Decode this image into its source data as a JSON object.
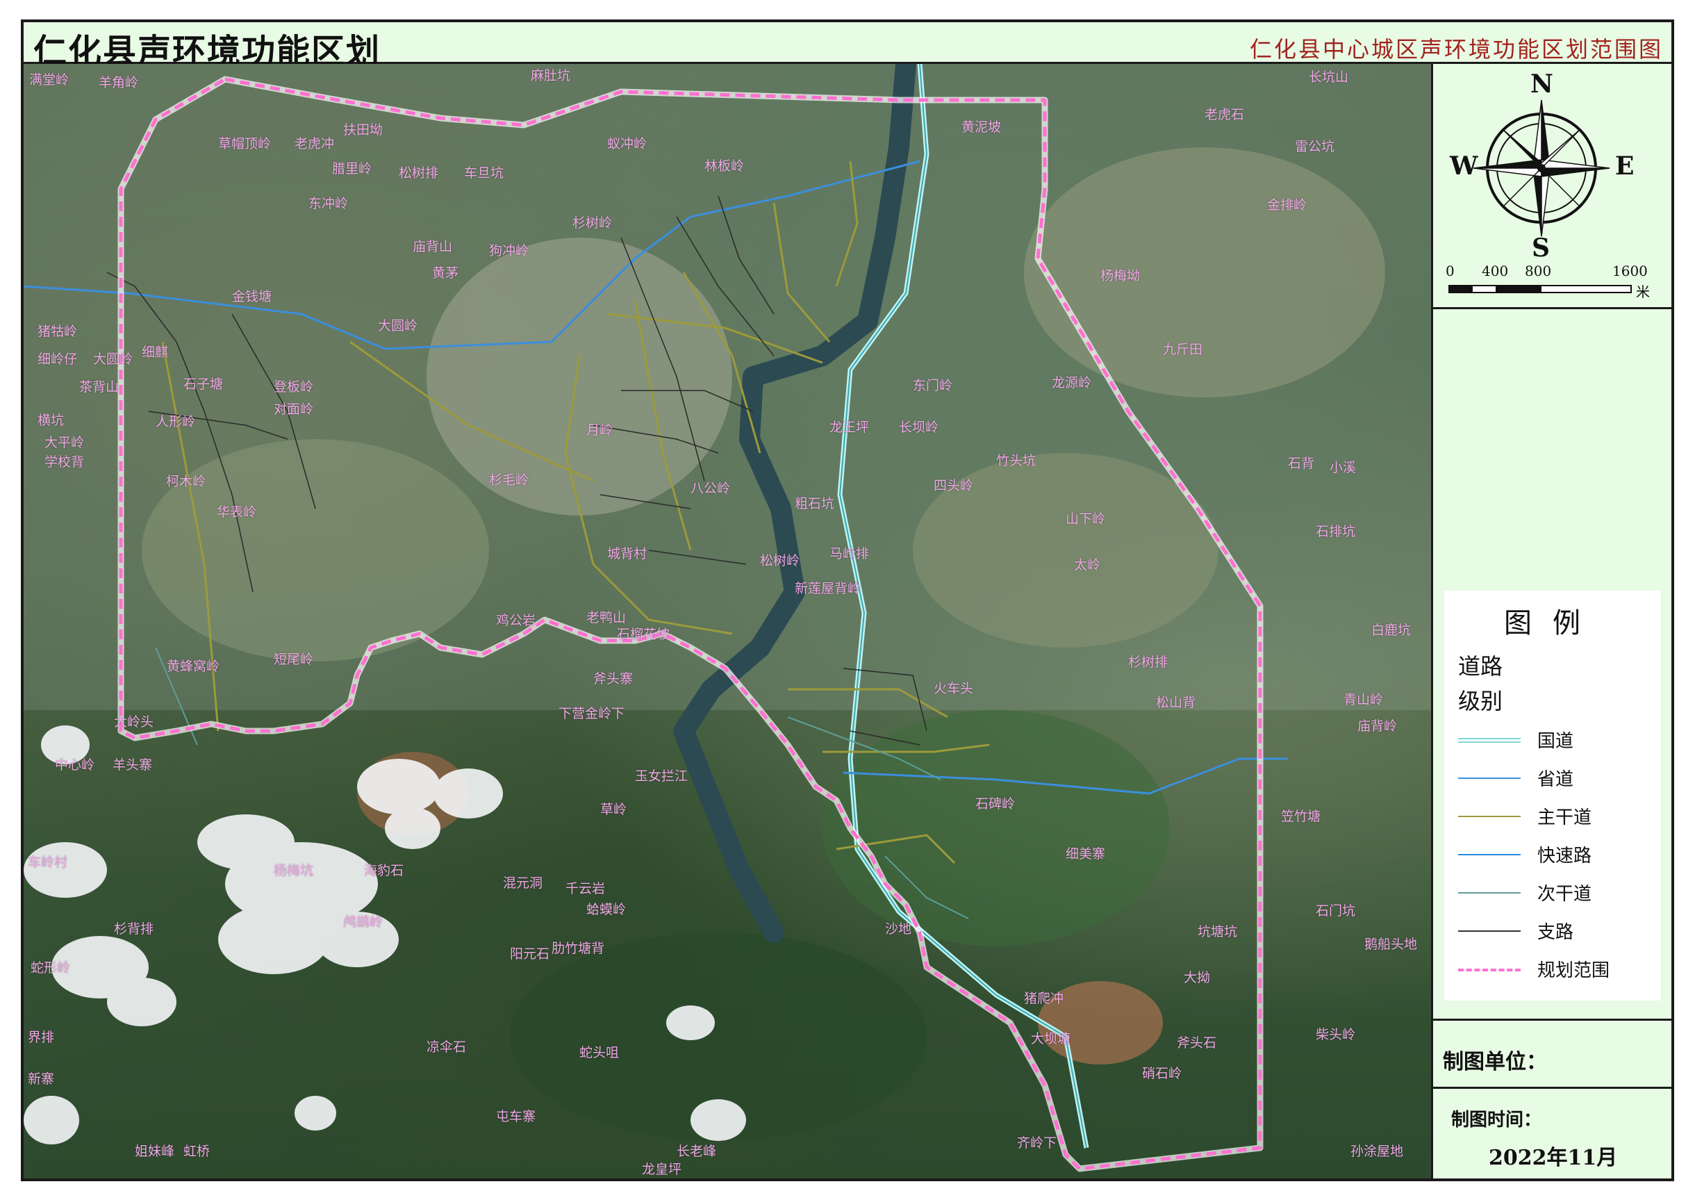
{
  "header": {
    "title": "仁化县声环境功能区划",
    "subtitle": "仁化县中心城区声环境功能区划范围图"
  },
  "compass": {
    "north": "N",
    "south": "S",
    "east": "E",
    "west": "W"
  },
  "scale_bar": {
    "ticks": [
      "0",
      "400",
      "800",
      "1600"
    ],
    "unit": "米"
  },
  "legend": {
    "title": "图例",
    "group_title": "道路",
    "group_subtitle": "级别",
    "items": [
      {
        "label": "国道",
        "color": "#7fd8d8",
        "style": "double"
      },
      {
        "label": "省道",
        "color": "#3b8fdc",
        "style": "solid"
      },
      {
        "label": "主干道",
        "color": "#9c9a3c",
        "style": "solid"
      },
      {
        "label": "快速路",
        "color": "#2a8ce0",
        "style": "solid"
      },
      {
        "label": "次干道",
        "color": "#5e9e96",
        "style": "solid"
      },
      {
        "label": "支路",
        "color": "#333333",
        "style": "solid"
      },
      {
        "label": "规划范围",
        "color": "#ff6fd0",
        "style": "dashed"
      }
    ]
  },
  "map_unit": {
    "label": "制图单位："
  },
  "map_time": {
    "label": "制图时间：",
    "value": "2022年11月"
  },
  "place_names": [
    "满堂岭",
    "羊角岭",
    "麻肚坑",
    "长坑山",
    "老虎石",
    "扶田坳",
    "草帽顶岭",
    "老虎冲",
    "黄泥坡",
    "蚁冲岭",
    "林板岭",
    "雷公坑",
    "腊里岭",
    "松树排",
    "车旦坑",
    "东冲岭",
    "金排岭",
    "杉树岭",
    "庙背山",
    "狗冲岭",
    "黄茅",
    "杨梅坳",
    "金钱塘",
    "大圆岭",
    "猪牯岭",
    "细岭仔",
    "大圆岭",
    "细麒",
    "石子塘",
    "茶背山",
    "登板岭",
    "对面岭",
    "九斤田",
    "东门岭",
    "龙源岭",
    "龙王坪",
    "长坝岭",
    "人形岭",
    "大平岭",
    "学校背",
    "横坑",
    "柯木岭",
    "杉毛岭",
    "月岭",
    "八公岭",
    "竹头坑",
    "四头岭",
    "石背",
    "小溪",
    "粗石坑",
    "山下岭",
    "华表岭",
    "城背村",
    "松树岭",
    "马岭排",
    "太岭",
    "石排坑",
    "新莲屋背岭",
    "黄蜂窝岭",
    "短尾岭",
    "鸡公岩",
    "老鸭山",
    "石榴花坡",
    "杉树排",
    "火车头",
    "斧头寨",
    "下营金岭下",
    "松山背",
    "青山岭",
    "庙背岭",
    "大岭头",
    "中心岭",
    "羊头寨",
    "玉女拦江",
    "草岭",
    "石碑岭",
    "笠竹塘",
    "车岭村",
    "杨梅坑",
    "海豹石",
    "混元洞",
    "千云岩",
    "蛤蟆岭",
    "杉背排",
    "鸬鹚岭",
    "细美寨",
    "阳元石",
    "肋竹塘背",
    "蛇形岭",
    "沙地",
    "坑塘坑",
    "界排",
    "猪爬冲",
    "大坝塘",
    "斧头石",
    "凉伞石",
    "蛇头咀",
    "新寨",
    "屯车寨",
    "姐妹峰",
    "虹桥",
    "长老峰",
    "龙皇坪",
    "齐岭下",
    "孙涂屋地",
    "鹅船头地",
    "大拗",
    "硝石岭",
    "柴头岭",
    "白鹿坑",
    "石门坑"
  ]
}
